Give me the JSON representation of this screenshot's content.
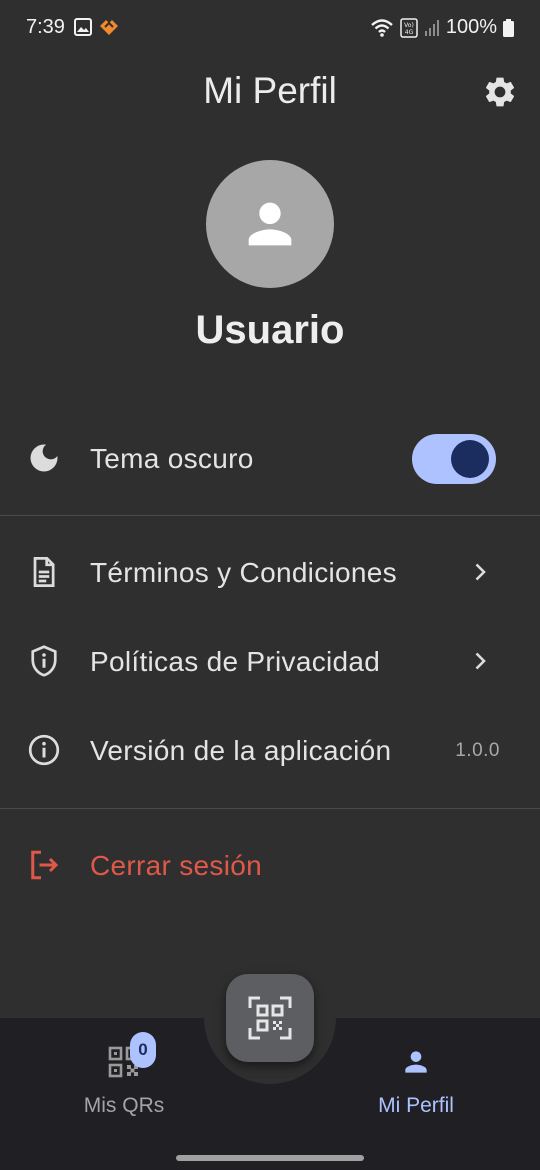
{
  "status_bar": {
    "time": "7:39",
    "left_icons": [
      "image-icon",
      "app-notification-icon"
    ],
    "right_icons": [
      "wifi-icon",
      "volte-4g-icon",
      "signal-icon",
      "battery-icon"
    ],
    "volte_text": "Vo) 4G",
    "battery": "100%"
  },
  "header": {
    "title": "Mi Perfil",
    "settings_icon": "gear-icon"
  },
  "profile": {
    "avatar_icon": "person-icon",
    "name": "Usuario"
  },
  "settings": {
    "dark_theme": {
      "icon": "moon-icon",
      "label": "Tema oscuro",
      "enabled": true
    },
    "terms": {
      "icon": "document-icon",
      "label": "Términos y Condiciones"
    },
    "privacy": {
      "icon": "shield-info-icon",
      "label": "Políticas de Privacidad"
    },
    "version": {
      "icon": "info-icon",
      "label": "Versión de la aplicación",
      "value": "1.0.0"
    },
    "logout": {
      "icon": "logout-icon",
      "label": "Cerrar sesión"
    }
  },
  "bottom_nav": {
    "fab_icon": "qr-scan-icon",
    "items": [
      {
        "label": "Mis QRs",
        "icon": "qr-code-icon",
        "badge": "0",
        "active": false
      },
      {
        "label": "Mi Perfil",
        "icon": "person-icon",
        "active": true
      }
    ]
  },
  "colors": {
    "background": "#2f2f2f",
    "nav_background": "#1f1f24",
    "accent": "#aec2ff",
    "accent_dark": "#1b2d5e",
    "logout_red": "#e0584a",
    "avatar_gray": "#a7a7a7"
  }
}
